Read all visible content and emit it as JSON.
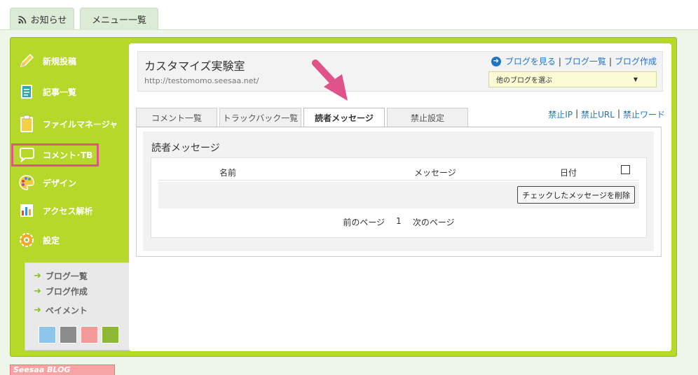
{
  "top_tabs": [
    {
      "label": "お知らせ",
      "icon": "rss-icon"
    },
    {
      "label": "メニュー一覧"
    }
  ],
  "sidebar": {
    "items": [
      {
        "label": "新規投稿",
        "icon": "pencil-icon"
      },
      {
        "label": "記事一覧",
        "icon": "document-icon"
      },
      {
        "label": "ファイルマネージャ",
        "icon": "clipboard-icon"
      },
      {
        "label": "コメント･TB",
        "icon": "speech-bubble-icon"
      },
      {
        "label": "デザイン",
        "icon": "palette-icon"
      },
      {
        "label": "アクセス解析",
        "icon": "bar-chart-icon"
      },
      {
        "label": "設定",
        "icon": "gear-icon"
      }
    ],
    "links": [
      {
        "label": "ブログ一覧"
      },
      {
        "label": "ブログ作成"
      },
      {
        "label": "ペイメント"
      }
    ],
    "swatches": [
      "#8ec5ea",
      "#8c8c8c",
      "#f29a9a",
      "#8cb834"
    ]
  },
  "blog": {
    "title": "カスタマイズ実験室",
    "url": "http://testomomo.seesaa.net/",
    "links": [
      "ブログを見る",
      "ブログ一覧",
      "ブログ作成"
    ],
    "select_value": "他のブログを選ぶ"
  },
  "tabs": [
    {
      "label": "コメント一覧"
    },
    {
      "label": "トラックバック一覧"
    },
    {
      "label": "読者メッセージ",
      "active": true
    },
    {
      "label": "禁止設定"
    }
  ],
  "ban_links": [
    "禁止IP",
    "禁止URL",
    "禁止ワード"
  ],
  "messages": {
    "title": "読者メッセージ",
    "columns": [
      "名前",
      "メッセージ",
      "日付"
    ],
    "delete_label": "チェックしたメッセージを削除",
    "pager": {
      "prev": "前のページ",
      "page": "1",
      "next": "次のページ"
    }
  },
  "banner_text": "Seesaa BLOG"
}
